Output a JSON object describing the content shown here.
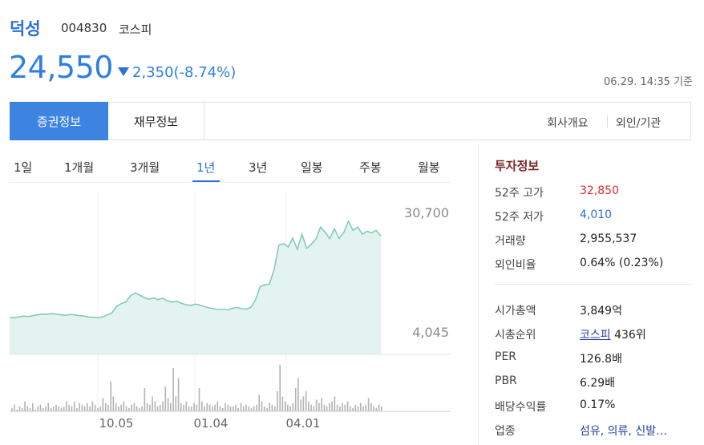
{
  "stock": {
    "name": "덕성",
    "code": "004830",
    "market": "코스피",
    "price": "24,550",
    "change": "2,350(-8.74%)",
    "timestamp": "06.29. 14:35 기준"
  },
  "tabs": {
    "active": "증권정보",
    "second": "재무정보",
    "right1": "회사개요",
    "right2": "외인/기관"
  },
  "periods": [
    "1일",
    "1개월",
    "3개월",
    "1년",
    "3년",
    "일봉",
    "주봉",
    "월봉"
  ],
  "selected_period": "1년",
  "chart_data": {
    "type": "area",
    "series": [
      {
        "values": [
          7200,
          7100,
          7300,
          7500,
          7400,
          7600,
          7800,
          8000,
          7900,
          8100,
          8000,
          7800,
          7700,
          7900,
          7800,
          7600,
          7500,
          7300,
          7200,
          7100,
          7300,
          7800,
          8200,
          9800,
          10500,
          10900,
          12400,
          13100,
          12600,
          12000,
          11600,
          11900,
          11500,
          11800,
          11200,
          10900,
          11100,
          10600,
          10300,
          10100,
          10400,
          10200,
          9800,
          9500,
          9300,
          9100,
          9200,
          9000,
          9400,
          9600,
          9300,
          9200,
          9600,
          11400,
          14700,
          15100,
          15300,
          18800,
          24700,
          25100,
          24300,
          26400,
          23700,
          27400,
          23900,
          24900,
          26200,
          29100,
          27800,
          26300,
          28700,
          26300,
          27800,
          30500,
          28300,
          29100,
          27400,
          28100,
          27700,
          28300,
          26900
        ]
      }
    ],
    "price_high_label": "30,700",
    "price_low_label": "4,045",
    "x_ticks": [
      "10.05",
      "01.04",
      "04.01"
    ],
    "volume": [
      2,
      4,
      1,
      3,
      2,
      6,
      3,
      2,
      5,
      1,
      3,
      4,
      2,
      3,
      5,
      2,
      3,
      4,
      3,
      2,
      3,
      6,
      4,
      3,
      6,
      2,
      5,
      4,
      3,
      5,
      3,
      6,
      4,
      2,
      3,
      8,
      5,
      4,
      18,
      9,
      5,
      3,
      4,
      6,
      3,
      2,
      4,
      5,
      3,
      2,
      3,
      14,
      5,
      4,
      9,
      6,
      3,
      4,
      6,
      15,
      8,
      5,
      26,
      9,
      20,
      5,
      4,
      6,
      3,
      3,
      5,
      4,
      14,
      6,
      3,
      5,
      4,
      3,
      4,
      6,
      3,
      2,
      5,
      4,
      3,
      3,
      4,
      2,
      5,
      3,
      4,
      3,
      2,
      3,
      4,
      10,
      6,
      3,
      2,
      5,
      4,
      3,
      12,
      28,
      9,
      6,
      4,
      3,
      5,
      14,
      20,
      7,
      9,
      12,
      6,
      4,
      3,
      7,
      5,
      8,
      4,
      3,
      5,
      6,
      9,
      4,
      3,
      5,
      4,
      6,
      3,
      2,
      4,
      3,
      5,
      3,
      4,
      8,
      5,
      3,
      2,
      4,
      3
    ]
  },
  "invest": {
    "title": "투자정보",
    "rows1": [
      {
        "label": "52주 고가",
        "value": "32,850"
      },
      {
        "label": "52주 저가",
        "value": "4,010"
      },
      {
        "label": "거래량",
        "value": "2,955,537"
      },
      {
        "label": "외인비율",
        "value": "0.64% (0.23%)"
      }
    ],
    "rows2": [
      {
        "label": "시가총액",
        "value": "3,849억"
      },
      {
        "label": "시총순위",
        "value_link": "코스피",
        "value_rest": " 436위"
      },
      {
        "label": "PER",
        "value": "126.8배"
      },
      {
        "label": "PBR",
        "value": "6.29배"
      },
      {
        "label": "배당수익률",
        "value": "0.17%"
      },
      {
        "label": "업종",
        "value": "섬유, 의류, 신발…"
      }
    ]
  },
  "colors": {
    "accent": "#3d83e0",
    "down": "#2f6fd6",
    "up": "#e0292f",
    "area": "#e3f4f0",
    "line": "#86c9bc"
  }
}
